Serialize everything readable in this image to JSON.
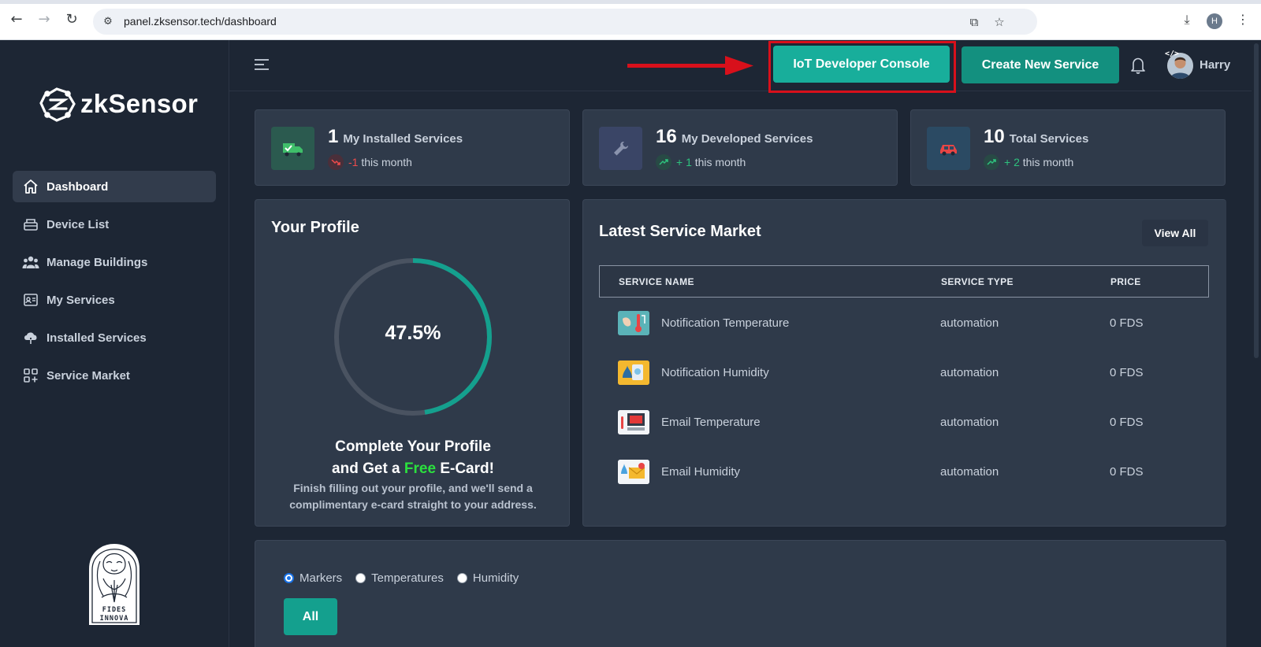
{
  "browser": {
    "url": "panel.zksensor.tech/dashboard",
    "profile_initial": "H"
  },
  "sidebar": {
    "logo_text": "zkSensor",
    "items": [
      {
        "label": "Dashboard",
        "icon": "home-icon",
        "active": true
      },
      {
        "label": "Device List",
        "icon": "device-icon"
      },
      {
        "label": "Manage Buildings",
        "icon": "people-icon"
      },
      {
        "label": "My Services",
        "icon": "id-card-icon"
      },
      {
        "label": "Installed Services",
        "icon": "cloud-download-icon"
      },
      {
        "label": "Service Market",
        "icon": "grid-plus-icon"
      }
    ],
    "footer_logo_text": "FIDES INNOVA"
  },
  "header": {
    "dev_console_label": "IoT Developer Console",
    "create_service_label": "Create New Service",
    "user_name": "Harry"
  },
  "stats": [
    {
      "value": "1",
      "label": "My Installed Services",
      "delta": "-1",
      "delta_suffix": "this month",
      "trend": "down"
    },
    {
      "value": "16",
      "label": "My Developed Services",
      "delta": "+ 1",
      "delta_suffix": "this month",
      "trend": "up"
    },
    {
      "value": "10",
      "label": "Total Services",
      "delta": "+ 2",
      "delta_suffix": "this month",
      "trend": "up"
    }
  ],
  "profile": {
    "title": "Your Profile",
    "completion_percent": 47.5,
    "completion_label": "47.5%",
    "cta_line1": "Complete Your Profile",
    "cta_line2_prefix": "and Get a",
    "cta_free": "Free",
    "cta_line2_suffix": "E-Card!",
    "description": "Finish filling out your profile, and we'll send a complimentary e-card straight to your address."
  },
  "market": {
    "title": "Latest Service Market",
    "view_all_label": "View All",
    "columns": [
      "SERVICE NAME",
      "SERVICE TYPE",
      "PRICE"
    ],
    "rows": [
      {
        "name": "Notification Temperature",
        "type": "automation",
        "price": "0 FDS"
      },
      {
        "name": "Notification Humidity",
        "type": "automation",
        "price": "0 FDS"
      },
      {
        "name": "Email Temperature",
        "type": "automation",
        "price": "0 FDS"
      },
      {
        "name": "Email Humidity",
        "type": "automation",
        "price": "0 FDS"
      }
    ]
  },
  "map_filters": {
    "options": [
      "Markers",
      "Temperatures",
      "Humidity"
    ],
    "selected": "Markers",
    "all_label": "All"
  },
  "colors": {
    "accent": "#14a08e",
    "highlight": "#d8101b",
    "background": "#1d2634",
    "card": "#2f3a4a"
  }
}
